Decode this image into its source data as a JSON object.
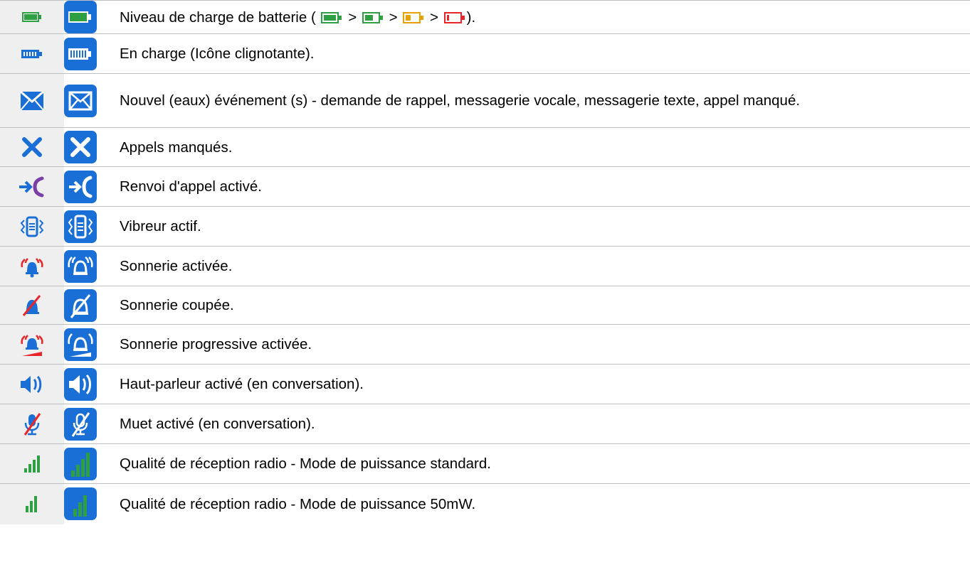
{
  "rows": [
    {
      "icon": "battery-level-icon",
      "text": "Niveau de charge de batterie (",
      "text_suffix": ").",
      "separator": ">",
      "levels": [
        "battery-full-icon",
        "battery-medium-icon",
        "battery-low-icon",
        "battery-empty-icon"
      ]
    },
    {
      "icon": "battery-charging-icon",
      "text": "En charge (Icône clignotante)."
    },
    {
      "icon": "new-event-envelope-icon",
      "text": "Nouvel (eaux) événement (s) - demande de rappel, messagerie vocale, messagerie texte, appel manqué."
    },
    {
      "icon": "missed-call-x-icon",
      "text": "Appels manqués."
    },
    {
      "icon": "call-forward-icon",
      "text": "Renvoi d'appel activé."
    },
    {
      "icon": "vibrate-icon",
      "text": "Vibreur actif."
    },
    {
      "icon": "ringer-on-icon",
      "text": "Sonnerie activée."
    },
    {
      "icon": "ringer-off-icon",
      "text": "Sonnerie coupée."
    },
    {
      "icon": "progressive-ringer-icon",
      "text": "Sonnerie progressive activée."
    },
    {
      "icon": "speaker-icon",
      "text": "Haut-parleur activé (en conversation)."
    },
    {
      "icon": "mute-microphone-icon",
      "text": "Muet activé (en conversation)."
    },
    {
      "icon": "signal-standard-icon",
      "text": "Qualité de réception radio - Mode de puissance standard."
    },
    {
      "icon": "signal-50mw-icon",
      "text": "Qualité de réception radio - Mode de puissance 50mW."
    }
  ],
  "colors": {
    "blue": "#1a6fd6",
    "green": "#2ea043",
    "orange": "#e8a200",
    "red": "#e8262a",
    "purple": "#7b3fa8",
    "row_bg": "#efefef",
    "rule": "#bfbfbf"
  }
}
